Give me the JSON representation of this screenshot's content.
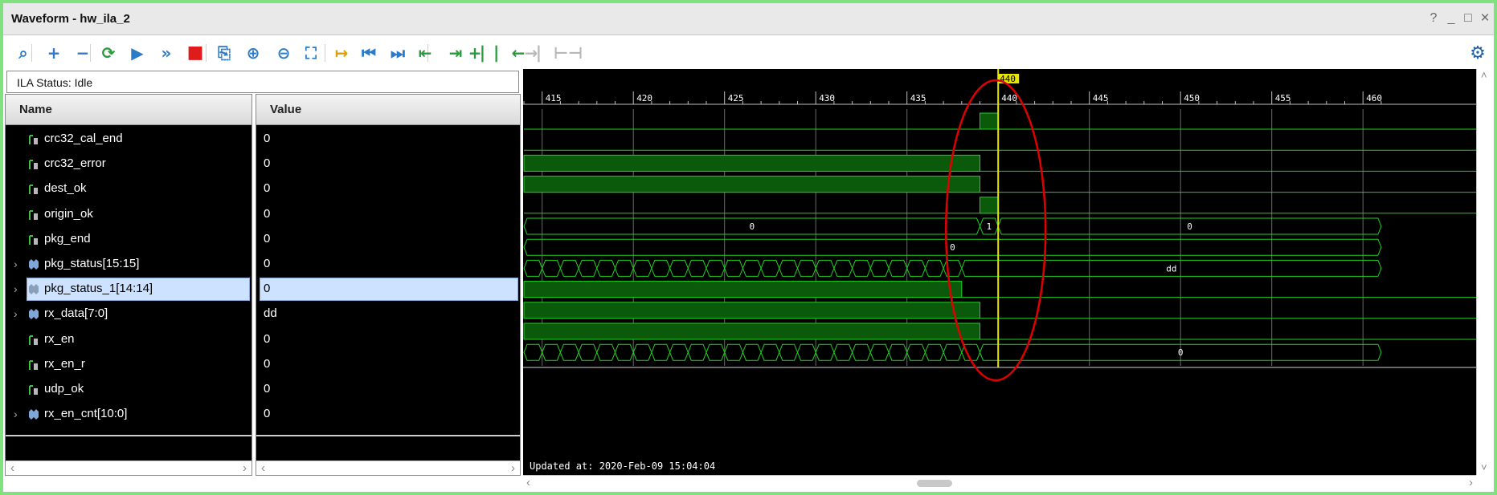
{
  "window": {
    "title": "Waveform - hw_ila_2",
    "controls": [
      "?",
      "_",
      "□",
      "×"
    ]
  },
  "toolbar": {
    "buttons": [
      {
        "name": "search-icon",
        "glyph": "⌕"
      },
      {
        "name": "add-icon",
        "glyph": "+"
      },
      {
        "name": "remove-icon",
        "glyph": "−"
      },
      {
        "name": "refresh-icon",
        "glyph": "⟳"
      },
      {
        "name": "run-trigger-icon",
        "glyph": "▶"
      },
      {
        "name": "run-immediate-icon",
        "glyph": "»"
      },
      {
        "name": "stop-icon",
        "glyph": "■"
      },
      {
        "name": "export-icon",
        "glyph": "⎘"
      },
      {
        "name": "zoom-in-icon",
        "glyph": "⊕"
      },
      {
        "name": "zoom-out-icon",
        "glyph": "⊖"
      },
      {
        "name": "zoom-fit-icon",
        "glyph": "⛶"
      },
      {
        "name": "go-to-cursor-icon",
        "glyph": "↦"
      },
      {
        "name": "go-to-start-icon",
        "glyph": "⏮"
      },
      {
        "name": "go-to-end-icon",
        "glyph": "⏭"
      },
      {
        "name": "previous-transition-icon",
        "glyph": "⇤"
      },
      {
        "name": "next-transition-icon",
        "glyph": "⇥"
      },
      {
        "name": "add-marker-icon",
        "glyph": "+⎸"
      },
      {
        "name": "previous-marker-icon",
        "glyph": "⎸←"
      },
      {
        "name": "next-marker-icon",
        "glyph": "→⎸"
      },
      {
        "name": "swap-cursors-icon",
        "glyph": "⊢⊣"
      }
    ],
    "settings_glyph": "⚙",
    "accent": "#2b7bc9",
    "stop_color": "#e01b1b"
  },
  "ila_status": "ILA Status: Idle",
  "columns": {
    "name": "Name",
    "value": "Value"
  },
  "signals": [
    {
      "name": "crc32_cal_end",
      "value": "0",
      "bus": false,
      "selected": false
    },
    {
      "name": "crc32_error",
      "value": "0",
      "bus": false,
      "selected": false
    },
    {
      "name": "dest_ok",
      "value": "0",
      "bus": false,
      "selected": false
    },
    {
      "name": "origin_ok",
      "value": "0",
      "bus": false,
      "selected": false
    },
    {
      "name": "pkg_end",
      "value": "0",
      "bus": false,
      "selected": false
    },
    {
      "name": "pkg_status[15:15]",
      "value": "0",
      "bus": true,
      "selected": false
    },
    {
      "name": "pkg_status_1[14:14]",
      "value": "0",
      "bus": true,
      "selected": true
    },
    {
      "name": "rx_data[7:0]",
      "value": "dd",
      "bus": true,
      "selected": false
    },
    {
      "name": "rx_en",
      "value": "0",
      "bus": false,
      "selected": false
    },
    {
      "name": "rx_en_r",
      "value": "0",
      "bus": false,
      "selected": false
    },
    {
      "name": "udp_ok",
      "value": "0",
      "bus": false,
      "selected": false
    },
    {
      "name": "rx_en_cnt[10:0]",
      "value": "0",
      "bus": true,
      "selected": false
    }
  ],
  "timeline": {
    "ticks": [
      "415",
      "420",
      "425",
      "430",
      "435",
      "440",
      "445",
      "450",
      "455",
      "460"
    ],
    "tick_start": 414,
    "tick_end": 461,
    "cursor": "440",
    "cursor_color": "#e6e600"
  },
  "waveforms": {
    "crc32_cal_end": {
      "type": "bit",
      "high": [
        [
          439,
          440
        ]
      ]
    },
    "crc32_error": {
      "type": "bit",
      "high": []
    },
    "dest_ok": {
      "type": "bit",
      "high": [
        [
          414,
          439
        ]
      ]
    },
    "origin_ok": {
      "type": "bit",
      "high": [
        [
          414,
          439
        ]
      ]
    },
    "pkg_end": {
      "type": "bit",
      "high": [
        [
          439,
          440
        ]
      ]
    },
    "pkg_status[15:15]": {
      "type": "bus",
      "segments": [
        {
          "from": 414,
          "to": 439,
          "label": "0"
        },
        {
          "from": 439,
          "to": 440,
          "label": "1"
        },
        {
          "from": 440,
          "to": 461,
          "label": "0"
        }
      ]
    },
    "pkg_status_1[14:14]": {
      "type": "bus",
      "segments": [
        {
          "from": 414,
          "to": 461,
          "label": "0"
        }
      ]
    },
    "rx_data[7:0]": {
      "type": "bus",
      "toggle_until": 438,
      "segments": [
        {
          "from": 438,
          "to": 461,
          "label": "dd"
        }
      ]
    },
    "rx_en": {
      "type": "bit",
      "high": [
        [
          414,
          438
        ]
      ]
    },
    "rx_en_r": {
      "type": "bit",
      "high": [
        [
          414,
          439
        ]
      ]
    },
    "udp_ok": {
      "type": "bit",
      "high": [
        [
          414,
          439
        ]
      ]
    },
    "rx_en_cnt[10:0]": {
      "type": "bus",
      "toggle_until": 439,
      "segments": [
        {
          "from": 439,
          "to": 461,
          "label": "0"
        }
      ]
    }
  },
  "colors": {
    "wave": "#1fd11f",
    "wave_fill": "#0b5a0b",
    "grid": "#6a6a6a",
    "highlight_ellipse": "#e00000",
    "frame": "#7fe27f"
  },
  "updated_at": "Updated at: 2020-Feb-09 15:04:04"
}
